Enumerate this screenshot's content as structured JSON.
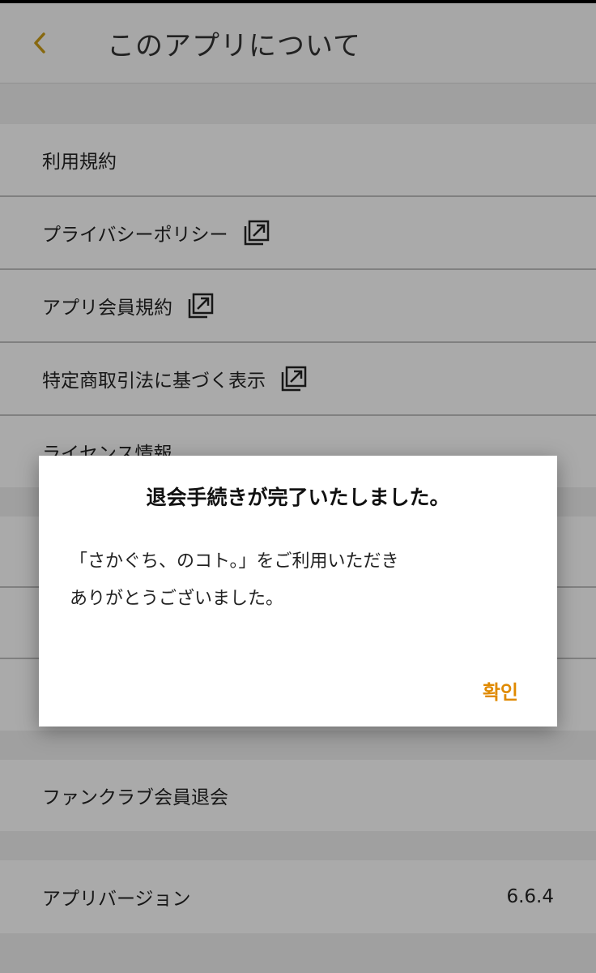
{
  "header": {
    "title": "このアプリについて",
    "back_icon": "chevron-left-icon",
    "accent_color": "#c79a17"
  },
  "menu": {
    "items": [
      {
        "label": "利用規約",
        "external": false
      },
      {
        "label": "プライバシーポリシー",
        "external": true
      },
      {
        "label": "アプリ会員規約",
        "external": true
      },
      {
        "label": "特定商取引法に基づく表示",
        "external": true
      },
      {
        "label": "ライセンス情報",
        "external": false
      }
    ],
    "withdraw": {
      "label": "ファンクラブ会員退会"
    },
    "version": {
      "label": "アプリバージョン",
      "value": "6.6.4"
    }
  },
  "dialog": {
    "title": "退会手続きが完了いたしました。",
    "message_line1": "「さかぐち、のコト。」をご利用いただき",
    "message_line2": "ありがとうございました。",
    "ok_label": "확인",
    "ok_color": "#e08a00"
  }
}
